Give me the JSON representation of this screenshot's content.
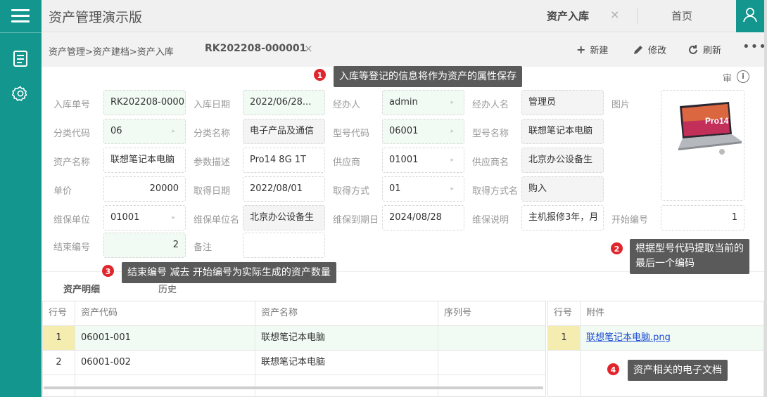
{
  "app": {
    "title": "资产管理演示版"
  },
  "tabs": {
    "active_label": "资产入库",
    "close_glyph": "×",
    "home_label": "首页"
  },
  "breadcrumb": {
    "path": "资产管理>资产建档>资产入库",
    "doc_no": "RK202208-000001",
    "close_glyph": "×"
  },
  "toolbar": {
    "new_label": "新建",
    "edit_label": "修改",
    "refresh_label": "刷新",
    "more_glyph": "•••"
  },
  "audit": {
    "label": "审",
    "info_glyph": "i"
  },
  "form": {
    "inbound_no": {
      "label": "入库单号",
      "value": "RK202208-0000"
    },
    "inbound_date": {
      "label": "入库日期",
      "value": "2022/06/28..."
    },
    "handler": {
      "label": "经办人",
      "value": "admin"
    },
    "handler_name": {
      "label": "经办人名",
      "value": "管理员"
    },
    "image": {
      "label": "图片"
    },
    "category_code": {
      "label": "分类代码",
      "value": "06"
    },
    "category_name": {
      "label": "分类名称",
      "value": "电子产品及通信"
    },
    "model_code": {
      "label": "型号代码",
      "value": "06001"
    },
    "model_name": {
      "label": "型号名称",
      "value": "联想笔记本电脑"
    },
    "asset_name": {
      "label": "资产名称",
      "value": "联想笔记本电脑"
    },
    "param_desc": {
      "label": "参数描述",
      "value": "Pro14 8G 1T"
    },
    "supplier": {
      "label": "供应商",
      "value": "01001"
    },
    "supplier_name": {
      "label": "供应商名",
      "value": "北京办公设备生"
    },
    "unit_price": {
      "label": "单价",
      "value": "20000"
    },
    "acquire_date": {
      "label": "取得日期",
      "value": "2022/08/01"
    },
    "acquire_method": {
      "label": "取得方式",
      "value": "01"
    },
    "acquire_method_name": {
      "label": "取得方式名",
      "value": "购入"
    },
    "warranty_unit": {
      "label": "维保单位",
      "value": "01001"
    },
    "warranty_unit_name": {
      "label": "维保单位名",
      "value": "北京办公设备生"
    },
    "warranty_expire": {
      "label": "维保到期日",
      "value": "2024/08/28"
    },
    "warranty_desc": {
      "label": "维保说明",
      "value": "主机报修3年，月"
    },
    "start_no": {
      "label": "开始编号",
      "value": "1"
    },
    "end_no": {
      "label": "结束编号",
      "value": "2"
    },
    "remark": {
      "label": "备注",
      "value": ""
    }
  },
  "photo": {
    "screen_text": "Pro14"
  },
  "subtabs": {
    "details": "资产明细",
    "history": "历史"
  },
  "detail_table": {
    "headers": [
      "行号",
      "资产代码",
      "资产名称",
      "序列号"
    ],
    "rows": [
      [
        "1",
        "06001-001",
        "联想笔记本电脑",
        ""
      ],
      [
        "2",
        "06001-002",
        "联想笔记本电脑",
        ""
      ]
    ]
  },
  "attach_table": {
    "headers": [
      "行号",
      "附件"
    ],
    "rows": [
      [
        "1",
        "联想笔记本电脑.png"
      ]
    ]
  },
  "callouts": {
    "c1": {
      "num": "1",
      "text": "入库等登记的信息将作为资产的属性保存"
    },
    "c2": {
      "num": "2",
      "line1": "根据型号代码提取当前的",
      "line2": "最后一个编码"
    },
    "c3": {
      "num": "3",
      "text": "结束编号 减去 开始编号为实际生成的资产数量"
    },
    "c4": {
      "num": "4",
      "text": "资产相关的电子文档"
    }
  },
  "colors": {
    "teal": "#12968e",
    "badge_red": "#e0262c",
    "callout_gray": "#5a5a5a",
    "field_green": "#f2fbf3",
    "row_selected": "#f5ecb0"
  }
}
